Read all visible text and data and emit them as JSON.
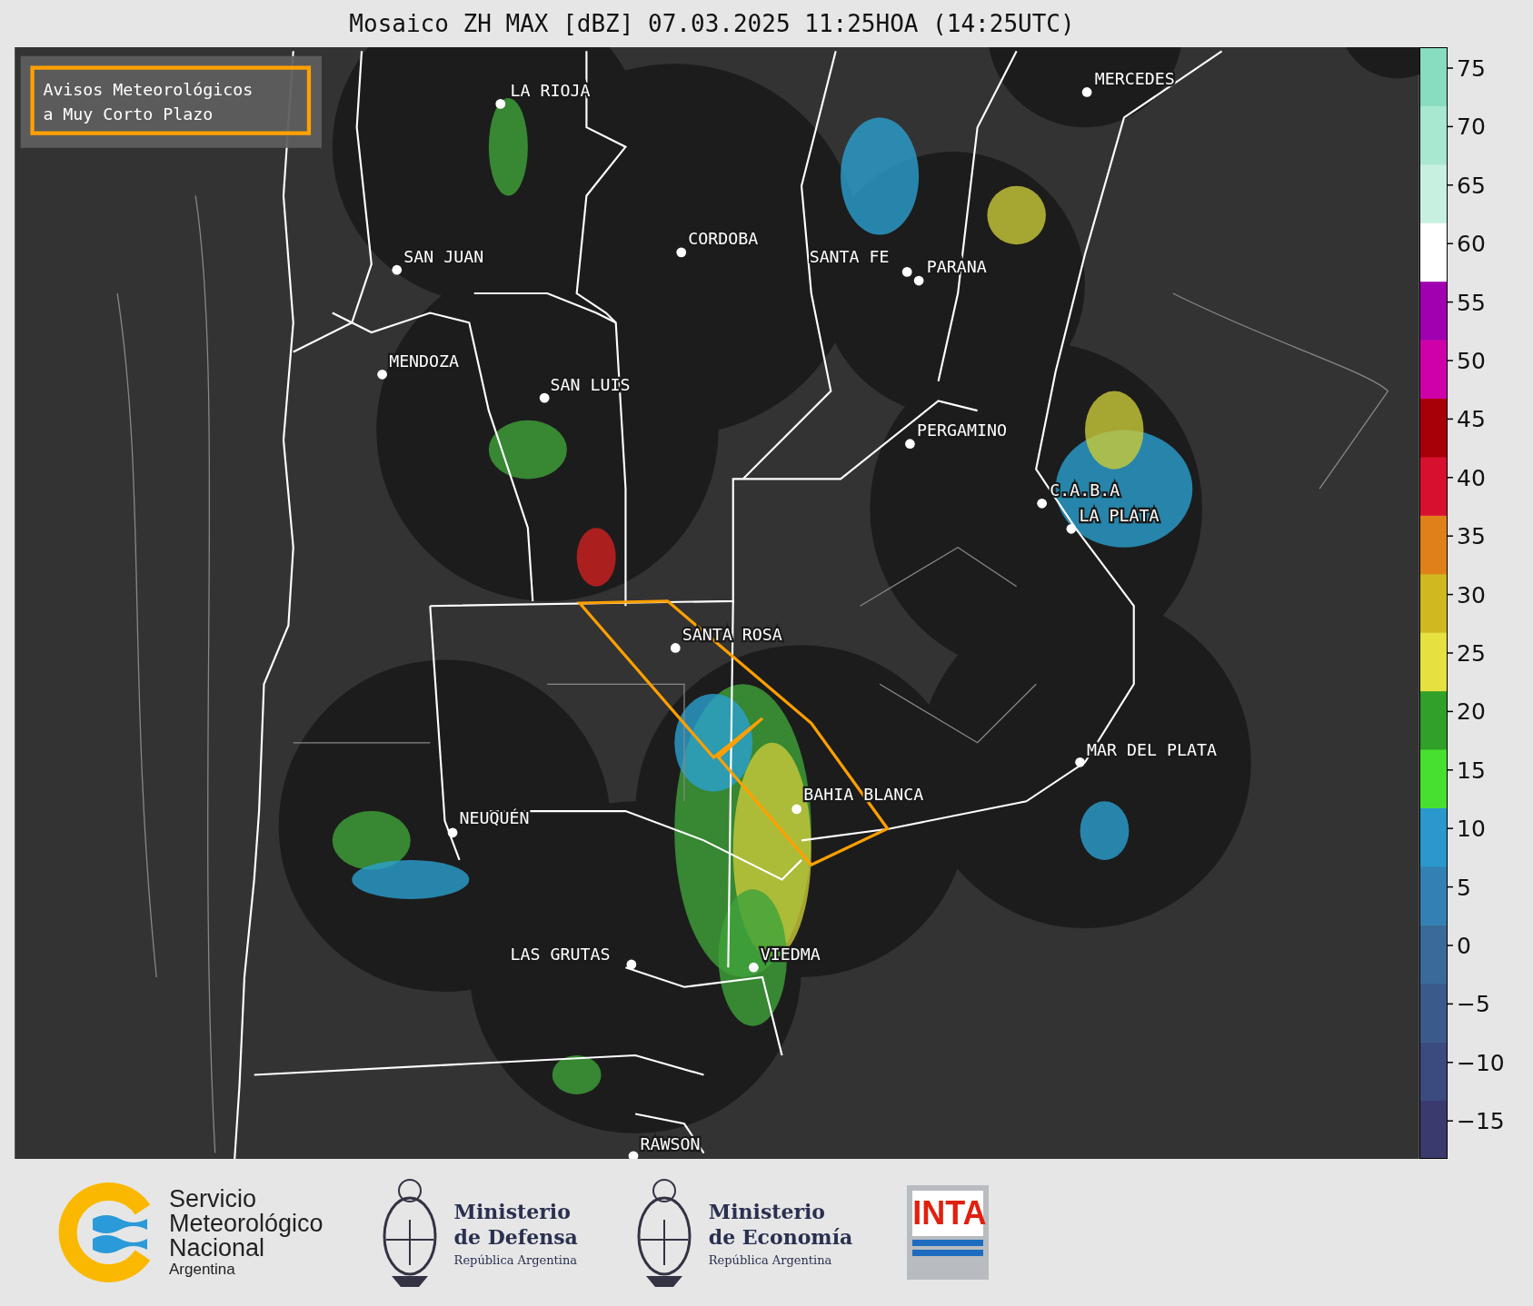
{
  "title": "Mosaico ZH MAX [dBZ] 07.03.2025 11:25HOA (14:25UTC)",
  "legend_box": {
    "lines": [
      "Avisos Meteorológicos",
      "a Muy Corto Plazo"
    ]
  },
  "cities": [
    {
      "name": "LA RIOJA"
    },
    {
      "name": "SAN JUAN"
    },
    {
      "name": "CORDOBA"
    },
    {
      "name": "SANTA FE"
    },
    {
      "name": "PARANA"
    },
    {
      "name": "MENDOZA"
    },
    {
      "name": "SAN LUIS"
    },
    {
      "name": "PERGAMINO"
    },
    {
      "name": "C.A.B.A"
    },
    {
      "name": "LA PLATA"
    },
    {
      "name": "SANTA ROSA"
    },
    {
      "name": "MAR DEL PLATA"
    },
    {
      "name": "BAHIA BLANCA"
    },
    {
      "name": "NEUQUÉN"
    },
    {
      "name": "LAS GRUTAS"
    },
    {
      "name": "VIEDMA"
    },
    {
      "name": "RAWSON"
    },
    {
      "name": "MERCEDES"
    }
  ],
  "colorbar": {
    "ticks": [
      "75",
      "70",
      "65",
      "60",
      "55",
      "50",
      "45",
      "40",
      "35",
      "30",
      "25",
      "20",
      "15",
      "10",
      "5",
      "0",
      "−5",
      "−10",
      "−15"
    ]
  },
  "footer": {
    "smn": [
      "Servicio",
      "Meteorológico",
      "Nacional",
      "Argentina"
    ],
    "defensa": [
      "Ministerio",
      "de Defensa",
      "República Argentina"
    ],
    "economia": [
      "Ministerio",
      "de Economía",
      "República Argentina"
    ],
    "inta": "INTA"
  }
}
